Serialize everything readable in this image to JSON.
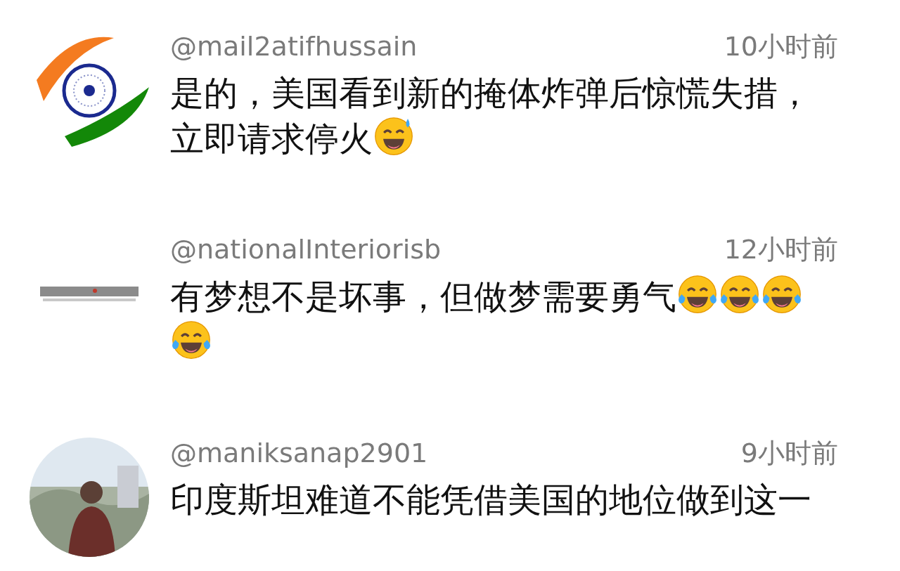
{
  "comments": [
    {
      "username": "@mail2atifhussain",
      "time": "10小时前",
      "text": "是的，美国看到新的掩体炸弹后惊慌失措，立即请求停火",
      "emojis": [
        {
          "kind": "sweat_smile"
        }
      ]
    },
    {
      "username": "@nationalInteriorisb",
      "time": "12小时前",
      "text": "有梦想不是坏事，但做梦需要勇气",
      "emojis": [
        {
          "kind": "joy"
        },
        {
          "kind": "joy"
        },
        {
          "kind": "joy"
        },
        {
          "kind": "joy"
        }
      ]
    },
    {
      "username": "@maniksanap2901",
      "time": "9小时前",
      "text": "印度斯坦难道不能凭借美国的地位做到这一"
    }
  ]
}
